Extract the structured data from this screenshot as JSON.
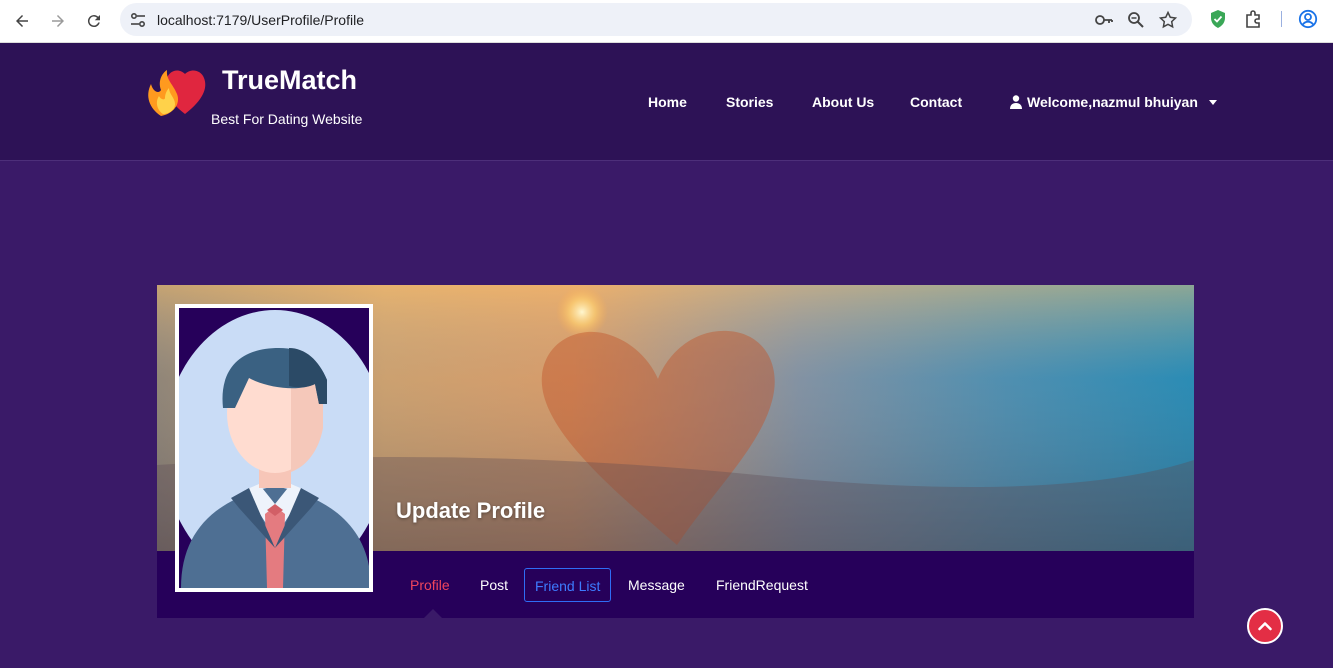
{
  "browser": {
    "url": "localhost:7179/UserProfile/Profile",
    "icons": [
      "back-arrow-icon",
      "forward-arrow-icon",
      "reload-icon",
      "site-info-icon",
      "password-key-icon",
      "zoom-icon",
      "bookmark-star-icon",
      "shield-extension-icon",
      "extensions-puzzle-icon",
      "profile-icon"
    ]
  },
  "header": {
    "brand": "TrueMatch",
    "tagline": "Best For Dating Website",
    "nav": {
      "home": "Home",
      "stories": "Stories",
      "about": "About Us",
      "contact": "Contact"
    },
    "welcome": "Welcome,nazmul bhuiyan"
  },
  "profile": {
    "title": "Update Profile",
    "tabs": {
      "profile": "Profile",
      "post": "Post",
      "friend_list": "Friend List",
      "message": "Message",
      "friend_request": "FriendRequest"
    }
  },
  "colors": {
    "page_bg": "#3a1a68",
    "header_bg": "#2d1256",
    "tabbar_bg": "#26005a",
    "active_tab": "#f0455c",
    "outlined_tab": "#3d7bff",
    "scroll_button": "#e32e45"
  }
}
